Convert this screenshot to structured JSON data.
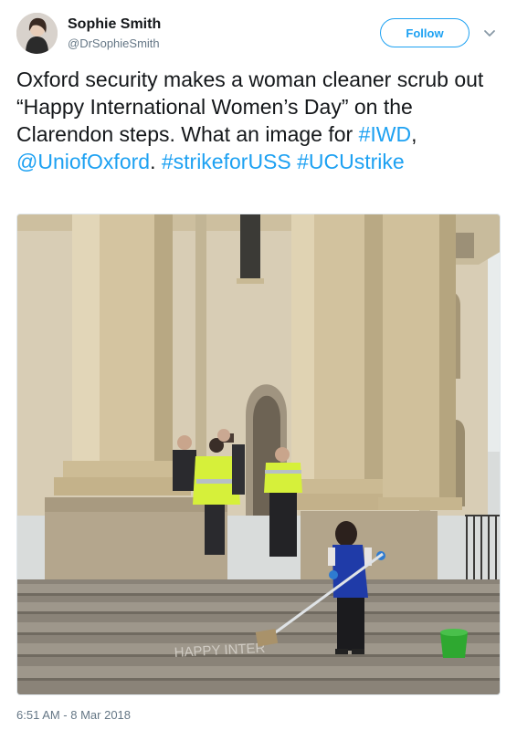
{
  "user": {
    "display_name": "Sophie Smith",
    "handle": "@DrSophieSmith",
    "follow_label": "Follow"
  },
  "tweet": {
    "text_1": "Oxford security makes a woman cleaner scrub out “Happy International Women’s Day” on the Clarendon steps. What an image for ",
    "hashtag_iwd": "#IWD",
    "sep_1": ", ",
    "mention": "@UniofOxford",
    "sep_2": ". ",
    "hashtag_strike": "#strikeforUSS",
    "sep_3": " ",
    "hashtag_ucu": "#UCUstrike"
  },
  "photo": {
    "chalk_text": "HAPPY INTER"
  },
  "timestamp": "6:51 AM - 8 Mar 2018",
  "colors": {
    "accent": "#1da1f2",
    "secondary_text": "#657786",
    "hi_vis": "#d6f03a"
  },
  "icons": {
    "more": "chevron-down-icon"
  }
}
